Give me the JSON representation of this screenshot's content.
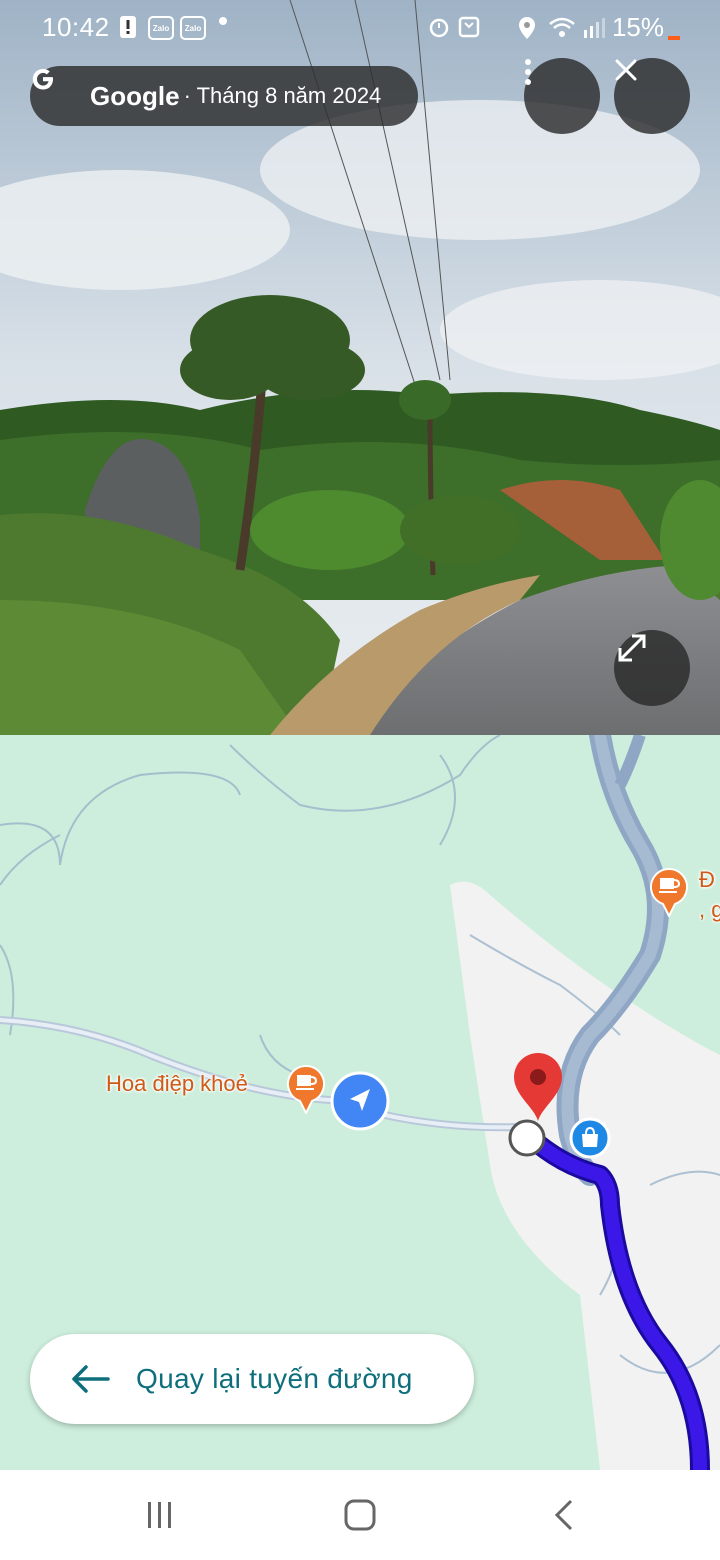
{
  "status_bar": {
    "time": "10:42",
    "notification_icons": [
      "alert-icon",
      "zalo-icon",
      "zalo-icon",
      "dot-icon"
    ],
    "zalo_label": "Zalo",
    "system_icons": [
      "alarm-icon",
      "nfc-icon",
      "location-icon",
      "wifi-icon",
      "signal-icon"
    ],
    "battery": "15%"
  },
  "street_view": {
    "provider": "Google",
    "date": "· Tháng 8 năm 2024",
    "more_icon": "more-vertical-icon",
    "close_icon": "close-icon",
    "expand_icon": "expand-icon"
  },
  "map": {
    "pois": [
      {
        "name": "Hoa điệp khoẻ",
        "icon": "cafe-icon"
      },
      {
        "name": "Đ\n, g",
        "icon": "cafe-icon"
      }
    ],
    "markers": [
      "red-pin-icon",
      "shopping-bag-icon",
      "navigation-arrow-icon"
    ],
    "colors": {
      "route": "#3b18e8",
      "road": "#8fa7c5",
      "land": "#cdeedc",
      "pin": "#e53935",
      "poi": "#f0782d",
      "nav": "#4285f4"
    }
  },
  "back_button": {
    "label": "Quay lại tuyến đường"
  },
  "nav_bar": {
    "buttons": [
      "recents-icon",
      "home-icon",
      "back-icon"
    ]
  }
}
